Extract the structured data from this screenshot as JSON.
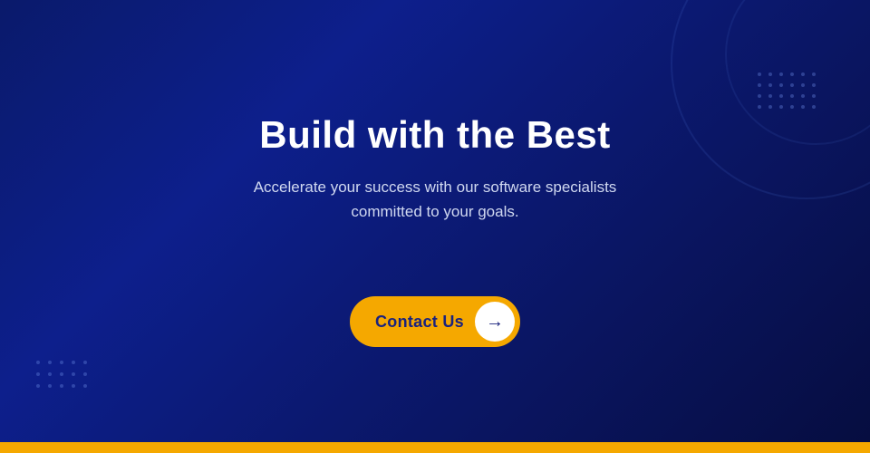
{
  "hero": {
    "title": "Build with the Best",
    "subtitle_line1": "Accelerate your success with our software specialists committed",
    "subtitle_line2": "to your goals.",
    "subtitle_full": "Accelerate your success with our software specialists committed to your goals.",
    "cta_label": "Contact Us",
    "cta_arrow": "→"
  },
  "colors": {
    "background_dark": "#0a1560",
    "accent_yellow": "#f5a800",
    "text_white": "#ffffff",
    "text_light": "#d0d8f0",
    "title_navy": "#1a237e"
  },
  "bottom_bar": {
    "color": "#f5a800"
  }
}
